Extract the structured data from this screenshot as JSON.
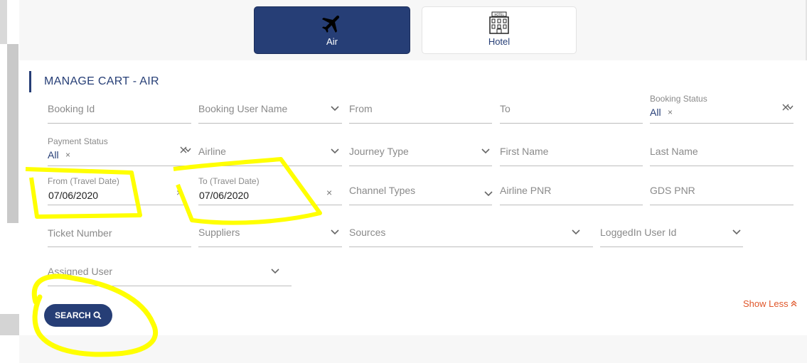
{
  "tabs": [
    {
      "label": "Air",
      "icon": "airplane-icon",
      "active": true
    },
    {
      "label": "Hotel",
      "icon": "hotel-building-icon",
      "sign": "HOTEL",
      "active": false
    }
  ],
  "panel": {
    "title": "MANAGE CART - AIR"
  },
  "fields": {
    "booking_id": {
      "placeholder": "Booking Id"
    },
    "booking_user_name": {
      "placeholder": "Booking User Name"
    },
    "from": {
      "placeholder": "From"
    },
    "to": {
      "placeholder": "To"
    },
    "booking_status": {
      "label": "Booking Status",
      "chip": "All",
      "chip_remove": "×"
    },
    "payment_status": {
      "label": "Payment Status",
      "chip": "All",
      "chip_remove": "×"
    },
    "airline": {
      "placeholder": "Airline"
    },
    "journey_type": {
      "placeholder": "Journey Type"
    },
    "first_name": {
      "placeholder": "First Name"
    },
    "last_name": {
      "placeholder": "Last Name"
    },
    "from_travel_date": {
      "label": "From (Travel Date)",
      "value": "07/06/2020",
      "clear": "×"
    },
    "to_travel_date": {
      "label": "To (Travel Date)",
      "value": "07/06/2020",
      "clear": "×"
    },
    "channel_types": {
      "placeholder": "Channel Types"
    },
    "airline_pnr": {
      "placeholder": "Airline PNR"
    },
    "gds_pnr": {
      "placeholder": "GDS PNR"
    },
    "ticket_number": {
      "placeholder": "Ticket Number"
    },
    "suppliers": {
      "placeholder": "Suppliers"
    },
    "sources": {
      "placeholder": "Sources"
    },
    "loggedin_user_id": {
      "placeholder": "LoggedIn User Id"
    },
    "assigned_user": {
      "placeholder": "Assigned User"
    }
  },
  "actions": {
    "search_label": "SEARCH",
    "show_less_label": "Show Less",
    "show_less_icon": "double-chevron-up-icon"
  },
  "colors": {
    "brand": "#263e76",
    "accent_link": "#e0562a",
    "highlight": "#ffff00"
  }
}
